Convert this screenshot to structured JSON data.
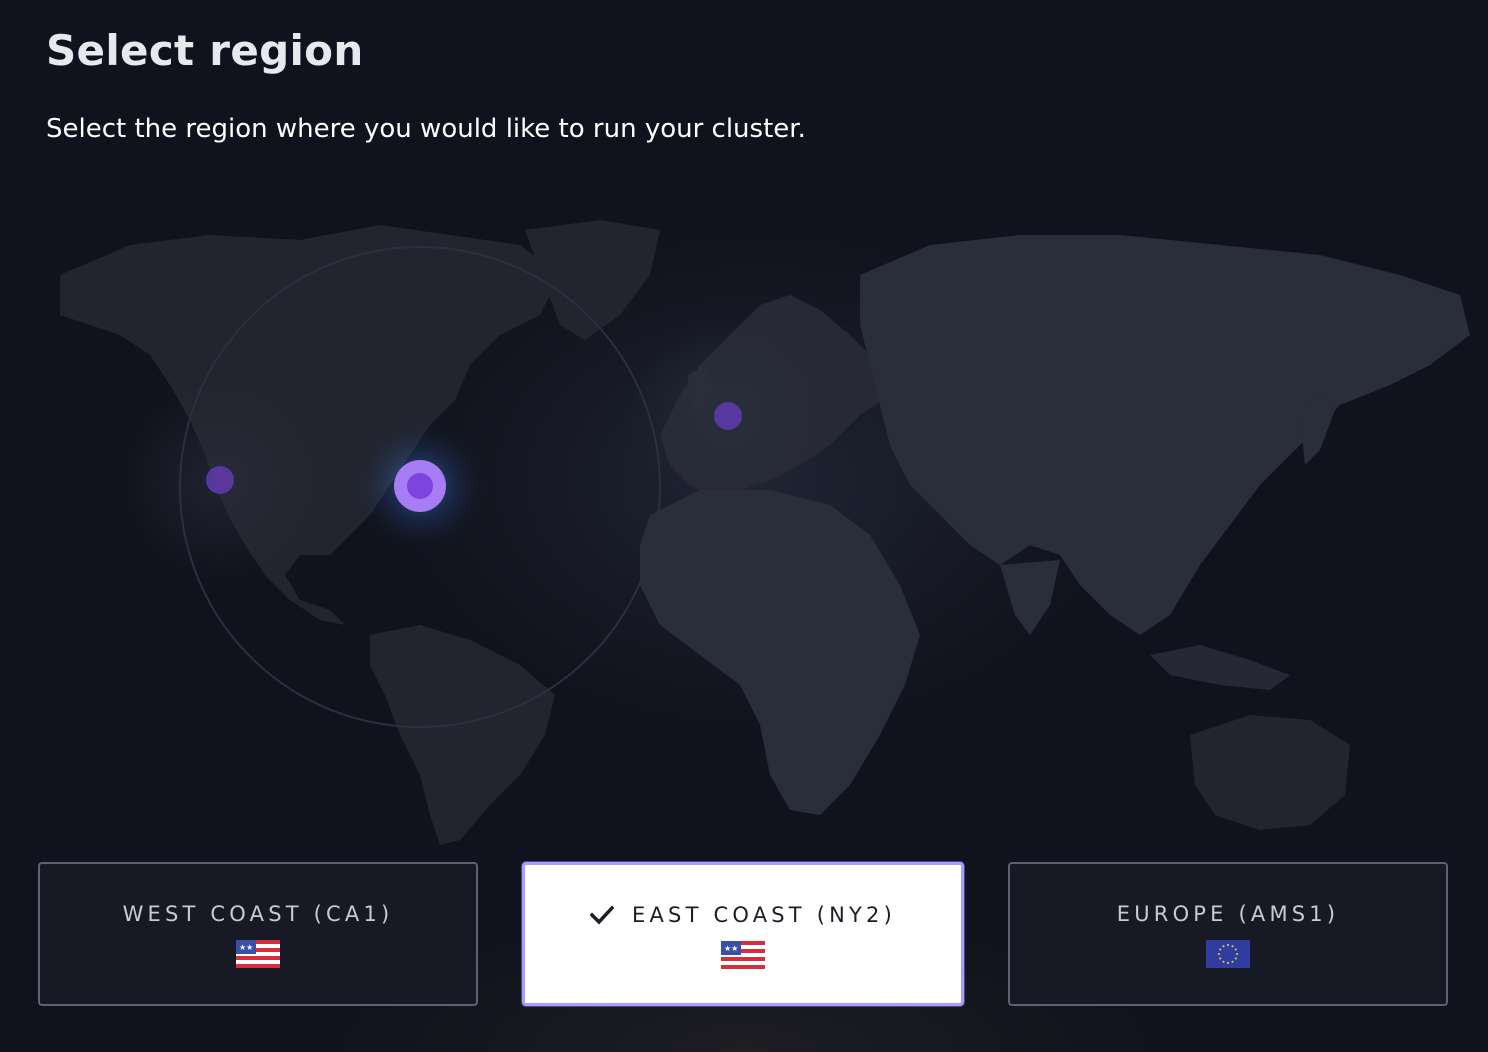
{
  "page": {
    "title": "Select region",
    "subtitle": "Select the region where you would like to run your cluster."
  },
  "map": {
    "markers": [
      {
        "name": "west-coast-marker",
        "region": "West Coast (CA1)",
        "selected": false
      },
      {
        "name": "east-coast-marker",
        "region": "East Coast (NY2)",
        "selected": true
      },
      {
        "name": "europe-marker",
        "region": "Europe (AMS1)",
        "selected": false
      }
    ],
    "colors": {
      "marker": "#7c4fd1",
      "marker_selected": "#a87cf5",
      "land": "#262a36",
      "background": "#10131d"
    }
  },
  "regions": [
    {
      "label": "WEST COAST (CA1)",
      "flag_icon": "us-flag-icon",
      "selected": false
    },
    {
      "label": "EAST COAST (NY2)",
      "flag_icon": "us-flag-icon",
      "selected": true,
      "icon": "checkmark-icon"
    },
    {
      "label": "EUROPE (AMS1)",
      "flag_icon": "eu-flag-icon",
      "selected": false
    }
  ],
  "colors": {
    "accent": "#a79cff",
    "card_border": "#5d6172",
    "selected_card_bg": "#ffffff"
  }
}
